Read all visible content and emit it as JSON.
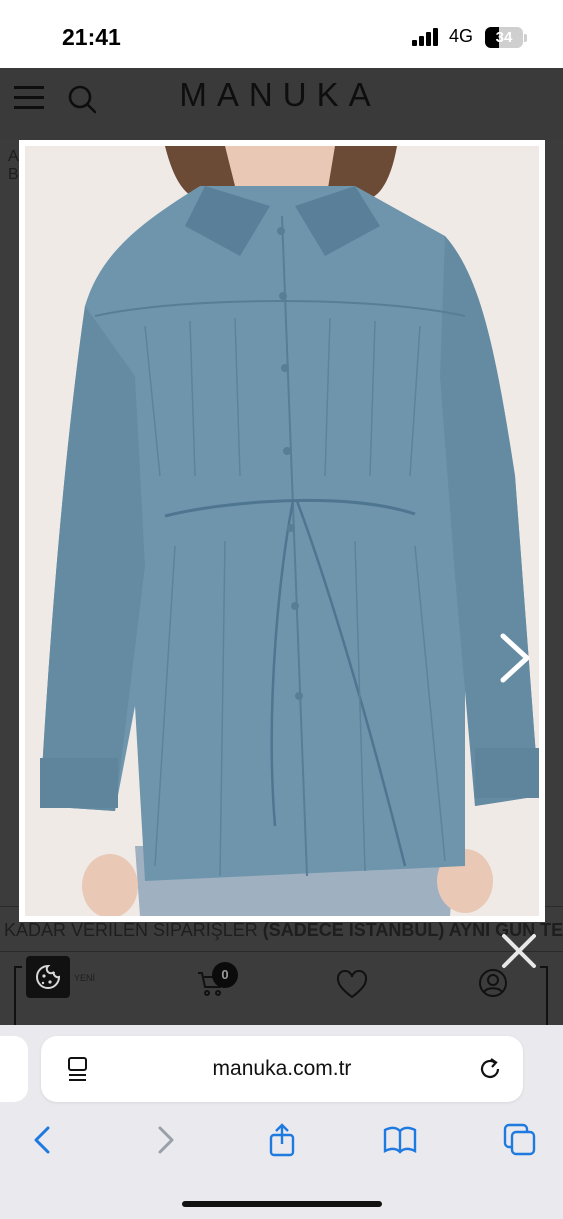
{
  "status_bar": {
    "time": "21:41",
    "network": "4G",
    "battery": "34"
  },
  "site": {
    "brand": "MANUKA",
    "bg_letters": [
      "A",
      "B"
    ],
    "marquee_prefix": "KADAR VERİLEN SİPARİŞLER ",
    "marquee_bold": "(SADECE İSTANBUL) AYNI GÜN TES",
    "nav_small_label": "YENİ",
    "cart_count": "0"
  },
  "lightbox": {
    "image_alt": "blue oversized button-up shirt with drawstring waist",
    "colors": {
      "shirt": "#6f95ad",
      "shirt_shadow": "#587d95",
      "background": "#efeae6",
      "denim": "#9fb0c0",
      "skin": "#e9c8b6",
      "hair": "#6b4a36"
    }
  },
  "browser": {
    "url": "manuka.com.tr"
  },
  "icons": [
    "menu-icon",
    "search-icon",
    "cookie-icon",
    "cart-icon",
    "heart-icon",
    "user-icon",
    "chevron-right-icon",
    "close-icon",
    "reader-icon",
    "reload-icon",
    "back-icon",
    "forward-icon",
    "share-icon",
    "bookmarks-icon",
    "tabs-icon"
  ]
}
